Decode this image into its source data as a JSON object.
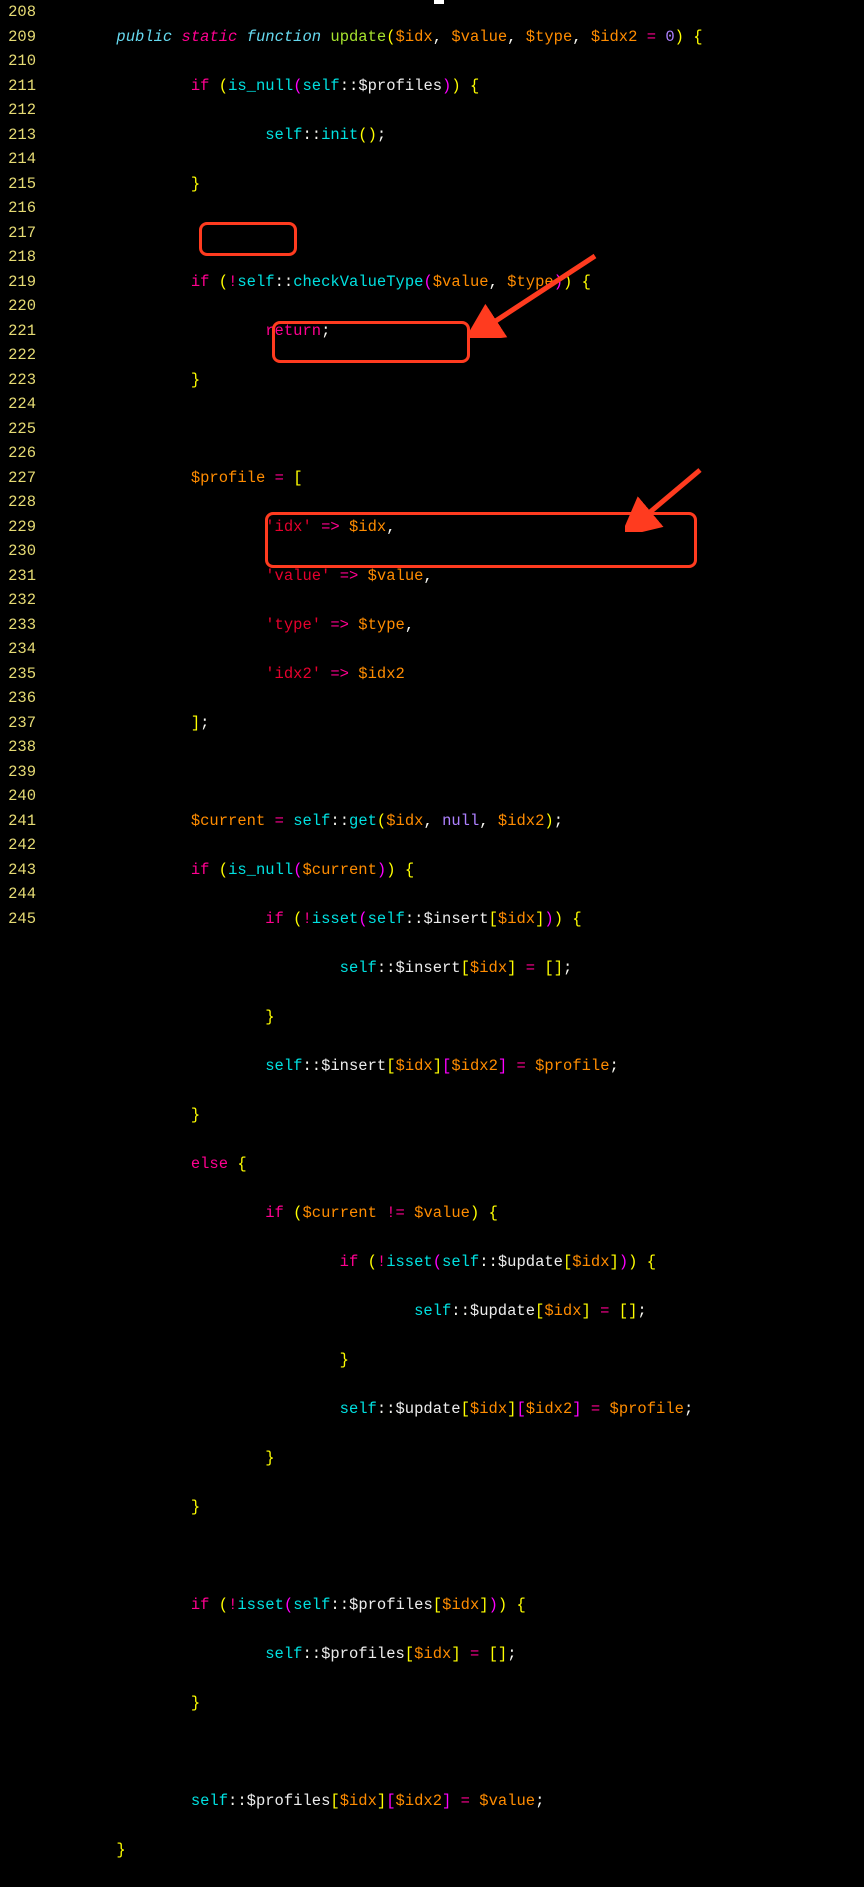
{
  "line_numbers": [
    "208",
    "209",
    "210",
    "211",
    "212",
    "213",
    "214",
    "215",
    "216",
    "217",
    "218",
    "219",
    "220",
    "221",
    "222",
    "223",
    "224",
    "225",
    "226",
    "227",
    "228",
    "229",
    "230",
    "231",
    "232",
    "233",
    "234",
    "235",
    "236",
    "237",
    "238",
    "239",
    "240",
    "241",
    "242",
    "243",
    "244",
    "245"
  ],
  "tokens": {
    "public": "public",
    "static": "static",
    "function": "function",
    "fname": "update",
    "idx": "$idx",
    "value": "$value",
    "type": "$type",
    "idx2": "$idx2",
    "zero": "0",
    "if": "if",
    "is_null": "is_null",
    "self": "self",
    "profiles": "$profiles",
    "init": "init",
    "checkValueType": "checkValueType",
    "return": "return",
    "profile": "$profile",
    "str_idx": "'idx'",
    "str_value": "'value'",
    "str_type": "'type'",
    "str_idx2": "'idx2'",
    "arrow": "=>",
    "current": "$current",
    "get": "get",
    "null": "null",
    "isset": "isset",
    "insert": "$insert",
    "update": "$update",
    "else": "else",
    "empty_arr": "[]"
  }
}
